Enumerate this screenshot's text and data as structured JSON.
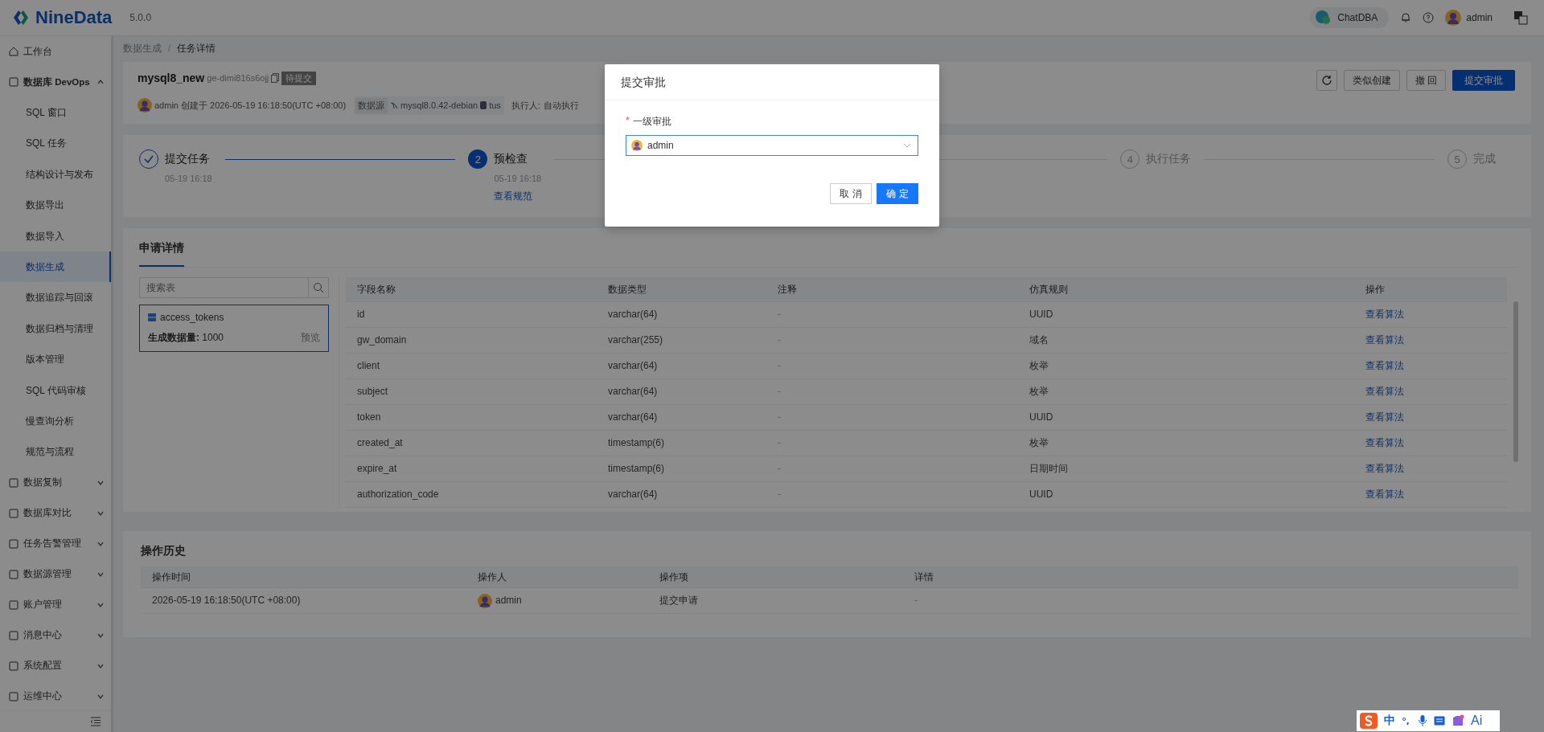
{
  "header": {
    "logo": "NineData",
    "version": "5.0.0",
    "chat": "ChatDBA",
    "user": "admin"
  },
  "sidebar": {
    "items": [
      {
        "label": "工作台",
        "kind": "link"
      },
      {
        "label": "数据库 DevOps",
        "kind": "group",
        "expanded": true,
        "children": [
          {
            "label": "SQL 窗口",
            "selected": false
          },
          {
            "label": "SQL 任务",
            "selected": false
          },
          {
            "label": "结构设计与发布",
            "selected": false
          },
          {
            "label": "数据导出",
            "selected": false
          },
          {
            "label": "数据导入",
            "selected": false
          },
          {
            "label": "数据生成",
            "selected": true
          },
          {
            "label": "数据追踪与回滚",
            "selected": false
          },
          {
            "label": "数据归档与清理",
            "selected": false
          },
          {
            "label": "版本管理",
            "selected": false
          },
          {
            "label": "SQL 代码审核",
            "selected": false
          },
          {
            "label": "慢查询分析",
            "selected": false
          },
          {
            "label": "规范与流程",
            "selected": false
          }
        ]
      },
      {
        "label": "数据复制",
        "kind": "group",
        "expanded": false
      },
      {
        "label": "数据库对比",
        "kind": "group",
        "expanded": false
      },
      {
        "label": "任务告警管理",
        "kind": "group",
        "expanded": false
      },
      {
        "label": "数据源管理",
        "kind": "group",
        "expanded": false
      },
      {
        "label": "账户管理",
        "kind": "group",
        "expanded": false
      },
      {
        "label": "消息中心",
        "kind": "group",
        "expanded": false
      },
      {
        "label": "系统配置",
        "kind": "group",
        "expanded": false
      },
      {
        "label": "运维中心",
        "kind": "group",
        "expanded": false
      }
    ]
  },
  "breadcrumb": {
    "items": [
      "数据生成",
      "任务详情"
    ],
    "separator": "/"
  },
  "task": {
    "name": "mysql8_new",
    "id": "ge-dimi816s6ojj",
    "status": "待提交",
    "creator": "admin",
    "created": "创建于 2026-05-19 16:18:50(UTC +08:00)",
    "datasource_label": "数据源",
    "datasource": "mysql8.0.42-debian",
    "database": "tus",
    "executor_label": "执行人:",
    "executor": "自动执行",
    "buttons": [
      {
        "label": "类似创建",
        "kind": "default"
      },
      {
        "label": "撤 回",
        "kind": "default"
      },
      {
        "label": "提交审批",
        "kind": "primary"
      }
    ]
  },
  "steps": [
    {
      "title": "提交任务",
      "time": "05-19 16:18",
      "completed": true,
      "active": false
    },
    {
      "number": "2",
      "title": "预检查",
      "time": "05-19 16:18",
      "link": "查看规范",
      "completed": false,
      "active": true
    },
    {
      "number": "4",
      "title": "执行任务",
      "completed": false,
      "active": false
    },
    {
      "number": "5",
      "title": "完成",
      "completed": false,
      "active": false
    }
  ],
  "detail": {
    "title": "申请详情",
    "search_placeholder": "搜索表",
    "tables": [
      {
        "name": "access_tokens",
        "count_label": "生成数据量:",
        "count": "1000",
        "action": "预览",
        "selected": true
      }
    ],
    "columns": [
      "字段名称",
      "数据类型",
      "注释",
      "仿真规则",
      "操作"
    ],
    "rows": [
      {
        "field": "id",
        "type": "varchar(64)",
        "comment": "-",
        "rule": "UUID",
        "action": "查看算法"
      },
      {
        "field": "gw_domain",
        "type": "varchar(255)",
        "comment": "-",
        "rule": "域名",
        "action": "查看算法"
      },
      {
        "field": "client",
        "type": "varchar(64)",
        "comment": "-",
        "rule": "枚举",
        "action": "查看算法"
      },
      {
        "field": "subject",
        "type": "varchar(64)",
        "comment": "-",
        "rule": "枚举",
        "action": "查看算法"
      },
      {
        "field": "token",
        "type": "varchar(64)",
        "comment": "-",
        "rule": "UUID",
        "action": "查看算法"
      },
      {
        "field": "created_at",
        "type": "timestamp(6)",
        "comment": "-",
        "rule": "枚举",
        "action": "查看算法"
      },
      {
        "field": "expire_at",
        "type": "timestamp(6)",
        "comment": "-",
        "rule": "日期时间",
        "action": "查看算法"
      },
      {
        "field": "authorization_code",
        "type": "varchar(64)",
        "comment": "-",
        "rule": "UUID",
        "action": "查看算法"
      }
    ]
  },
  "history": {
    "title": "操作历史",
    "columns": [
      "操作时间",
      "操作人",
      "操作项",
      "详情"
    ],
    "rows": [
      {
        "time": "2026-05-19 16:18:50(UTC +08:00)",
        "user": "admin",
        "action": "提交申请",
        "detail": "-"
      }
    ]
  },
  "modal": {
    "title": "提交审批",
    "required_mark": "*",
    "field_label": "一级审批",
    "value": "admin",
    "buttons": [
      {
        "label": "取 消",
        "kind": "default"
      },
      {
        "label": "确 定",
        "kind": "primary"
      }
    ]
  },
  "ime": {
    "mode": "中",
    "ai": "Ai"
  }
}
